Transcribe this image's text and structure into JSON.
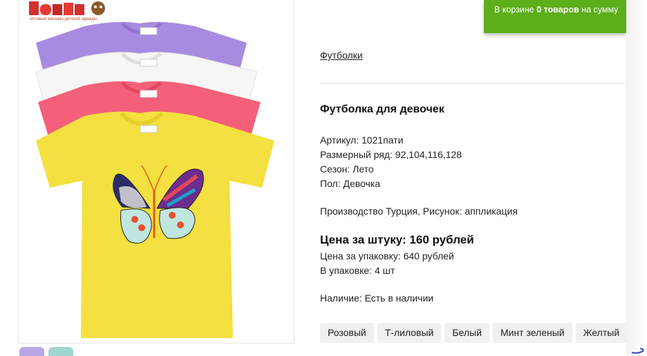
{
  "logo": {
    "brand": "ТомиКо",
    "tagline": "оптовый магазин детской одежды"
  },
  "cart": {
    "prefix": "В корзине ",
    "count": "0 товаров",
    "suffix": " на сумму"
  },
  "breadcrumb": "Футболки",
  "product": {
    "title": "Футболка для девочек",
    "specs": [
      "Артикул: 1021пати",
      "Размерный ряд: 92,104,116,128",
      "Сезон: Лето",
      "Пол: Девочка"
    ],
    "production": "Производство Турция, Рисунок: аппликация",
    "price_main": "Цена за штуку: 160 рублей",
    "price_pack": "Цена за упаковку: 640 рублей",
    "pack_size": "В упаковке: 4 шт",
    "availability": "Наличие: Есть в наличии",
    "colors": [
      "Розовый",
      "Т-лиловый",
      "Белый",
      "Минт зеленый",
      "Желтый"
    ]
  },
  "image_colors": {
    "lilac": "#a78be0",
    "white": "#f6f6f4",
    "pink": "#f4607a",
    "yellow": "#f4e040",
    "accent": "#5cae1a"
  }
}
